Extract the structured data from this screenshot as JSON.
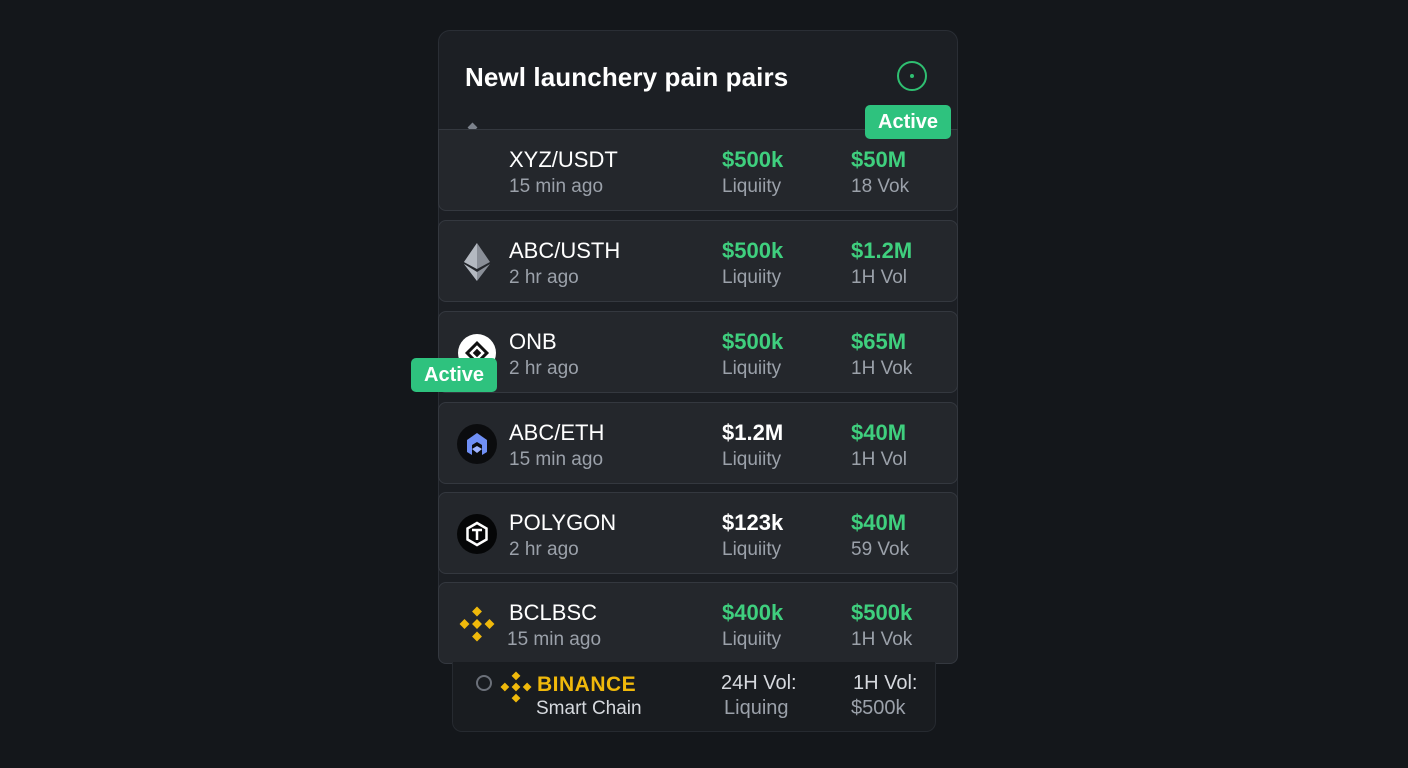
{
  "header": {
    "title": "Newl launchery pain pairs",
    "status_icon": "status-dot-icon"
  },
  "badges": {
    "top": "Active",
    "side": "Active"
  },
  "colors": {
    "accent_green": "#3fcf7e",
    "badge_green": "#2ec27e",
    "binance_yellow": "#f0b90b",
    "background": "#14171b"
  },
  "pairs": [
    {
      "name": "XYZ/USDT",
      "time": "15 min ago",
      "liquidity": "$500k",
      "liquidity_label": "Liquiity",
      "volume": "$50M",
      "volume_label": "18 Vok",
      "icon": "none"
    },
    {
      "name": "ABC/USTH",
      "time": "2 hr ago",
      "liquidity": "$500k",
      "liquidity_label": "Liquiity",
      "volume": "$1.2M",
      "volume_label": "1H Vol",
      "icon": "ethereum-icon"
    },
    {
      "name": "ONB",
      "time": "2 hr ago",
      "liquidity": "$500k",
      "liquidity_label": "Liquiity",
      "volume": "$65M",
      "volume_label": "1H Vok",
      "icon": "onb-token-icon"
    },
    {
      "name": "ABC/ETH",
      "time": "15 min ago",
      "liquidity": "$1.2M",
      "liquidity_label": "Liquiity",
      "volume": "$40M",
      "volume_label": "1H Vol",
      "icon": "abc-token-icon"
    },
    {
      "name": "POLYGON",
      "time": "2 hr ago",
      "liquidity": "$123k",
      "liquidity_label": "Liquiity",
      "volume": "$40M",
      "volume_label": "59 Vok",
      "icon": "polygon-icon"
    },
    {
      "name": "BCLBSC",
      "time": "15 min ago",
      "liquidity": "$400k",
      "liquidity_label": "Liquiity",
      "volume": "$500k",
      "volume_label": "1H Vok",
      "icon": "binance-icon"
    }
  ],
  "footer": {
    "brand": "BINANCE",
    "chain": "Smart Chain",
    "col1_label": "24H Vol:",
    "col1_value": "Liquing",
    "col2_label": "1H Vol:",
    "col2_value": "$500k"
  }
}
